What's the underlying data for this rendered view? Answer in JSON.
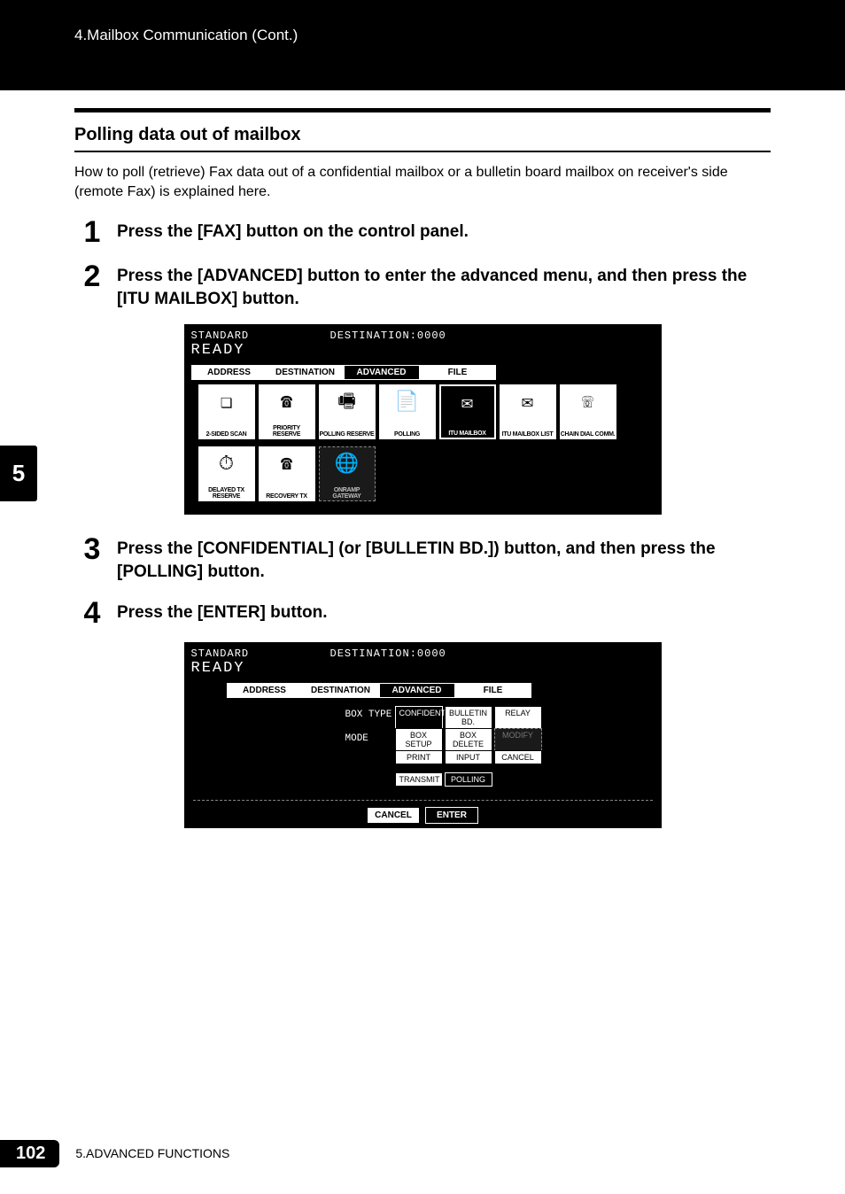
{
  "header": {
    "breadcrumb": "4.Mailbox Communication (Cont.)"
  },
  "section": {
    "title": "Polling data out of mailbox",
    "intro": "How to poll (retrieve) Fax data out of a confidential mailbox or a bulletin board mailbox on receiver's side (remote Fax) is explained here."
  },
  "steps": {
    "s1": {
      "num": "1",
      "text": "Press the [FAX] button on the control panel."
    },
    "s2": {
      "num": "2",
      "text": "Press the [ADVANCED] button to enter the advanced menu, and then press the [ITU MAILBOX] button."
    },
    "s3": {
      "num": "3",
      "text": "Press the [CONFIDENTIAL] (or [BULLETIN BD.]) button, and then press the [POLLING] button."
    },
    "s4": {
      "num": "4",
      "text": "Press the [ENTER] button."
    }
  },
  "lcd_common": {
    "standard": "STANDARD",
    "destination": "DESTINATION:0000",
    "ready": "READY",
    "tabs": {
      "address": "ADDRESS",
      "destination": "DESTINATION",
      "advanced": "ADVANCED",
      "file": "FILE"
    }
  },
  "lcd1_icons": {
    "r1": [
      {
        "name": "two-sided-scan",
        "label": "2-SIDED SCAN",
        "glyph": "❏"
      },
      {
        "name": "priority-reserve",
        "label": "PRIORITY RESERVE",
        "glyph": "☎"
      },
      {
        "name": "polling-reserve",
        "label": "POLLING RESERVE",
        "glyph": "🖷"
      },
      {
        "name": "polling",
        "label": "POLLING",
        "glyph": "📄"
      },
      {
        "name": "itu-mailbox",
        "label": "ITU MAILBOX",
        "glyph": "✉",
        "active": true
      },
      {
        "name": "itu-mailbox-list",
        "label": "ITU MAILBOX LIST",
        "glyph": "✉"
      },
      {
        "name": "chain-dial-comm",
        "label": "CHAIN DIAL COMM.",
        "glyph": "☏"
      }
    ],
    "r2": [
      {
        "name": "delayed-tx-reserve",
        "label": "DELAYED TX RESERVE",
        "glyph": "⏱"
      },
      {
        "name": "recovery-tx",
        "label": "RECOVERY TX",
        "glyph": "☎"
      },
      {
        "name": "onramp-gateway",
        "label": "ONRAMP GATEWAY",
        "glyph": "🌐",
        "dashed": true
      }
    ]
  },
  "lcd2": {
    "labels": {
      "box_type": "BOX TYPE",
      "mode": "MODE"
    },
    "row1": [
      {
        "name": "confidential",
        "label": "CONFIDENTIAL",
        "style": "dark"
      },
      {
        "name": "bulletin-bd",
        "label": "BULLETIN BD.",
        "style": "light"
      },
      {
        "name": "relay",
        "label": "RELAY",
        "style": "light"
      }
    ],
    "row2": [
      {
        "name": "box-setup",
        "label": "BOX SETUP",
        "style": "light"
      },
      {
        "name": "box-delete",
        "label": "BOX DELETE",
        "style": "light"
      },
      {
        "name": "modify",
        "label": "MODIFY",
        "style": "dashed"
      }
    ],
    "row3": [
      {
        "name": "print",
        "label": "PRINT",
        "style": "light"
      },
      {
        "name": "input",
        "label": "INPUT",
        "style": "light"
      },
      {
        "name": "cancel",
        "label": "CANCEL",
        "style": "light"
      }
    ],
    "row4": [
      {
        "name": "transmit",
        "label": "TRANSMIT",
        "style": "light"
      },
      {
        "name": "polling",
        "label": "POLLING",
        "style": "dark"
      }
    ],
    "bottom": [
      {
        "name": "cancel-bottom",
        "label": "CANCEL",
        "style": "light"
      },
      {
        "name": "enter",
        "label": "ENTER",
        "style": "dark"
      }
    ]
  },
  "side_tab": "5",
  "footer": {
    "page": "102",
    "text": "5.ADVANCED FUNCTIONS"
  }
}
